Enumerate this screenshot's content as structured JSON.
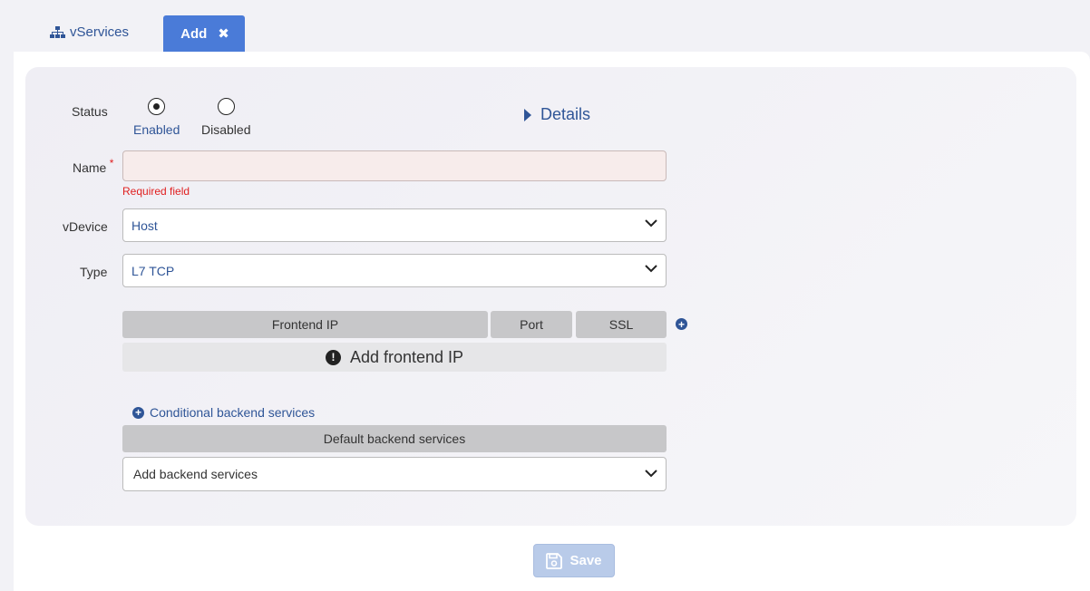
{
  "tabs": {
    "vservices_label": "vServices",
    "add_label": "Add",
    "close_glyph": "✖"
  },
  "form": {
    "status": {
      "label": "Status",
      "options": [
        {
          "label": "Enabled",
          "selected": true
        },
        {
          "label": "Disabled",
          "selected": false
        }
      ]
    },
    "details_label": "Details",
    "name": {
      "label": "Name",
      "required_marker": "*",
      "value": "",
      "error": "Required field"
    },
    "vdevice": {
      "label": "vDevice",
      "value": "Host"
    },
    "type": {
      "label": "Type",
      "value": "L7 TCP"
    },
    "frontend_table": {
      "columns": [
        "Frontend IP",
        "Port",
        "SSL"
      ],
      "empty_text": "Add frontend IP"
    },
    "conditional_backend_label": "Conditional backend services",
    "default_backend_label": "Default backend services",
    "add_backend_placeholder": "Add backend services",
    "save_label": "Save"
  },
  "colors": {
    "accent": "#2f5597",
    "tab_active": "#4a7bd8",
    "error": "#e02020",
    "save_disabled": "#b9cbe9"
  }
}
